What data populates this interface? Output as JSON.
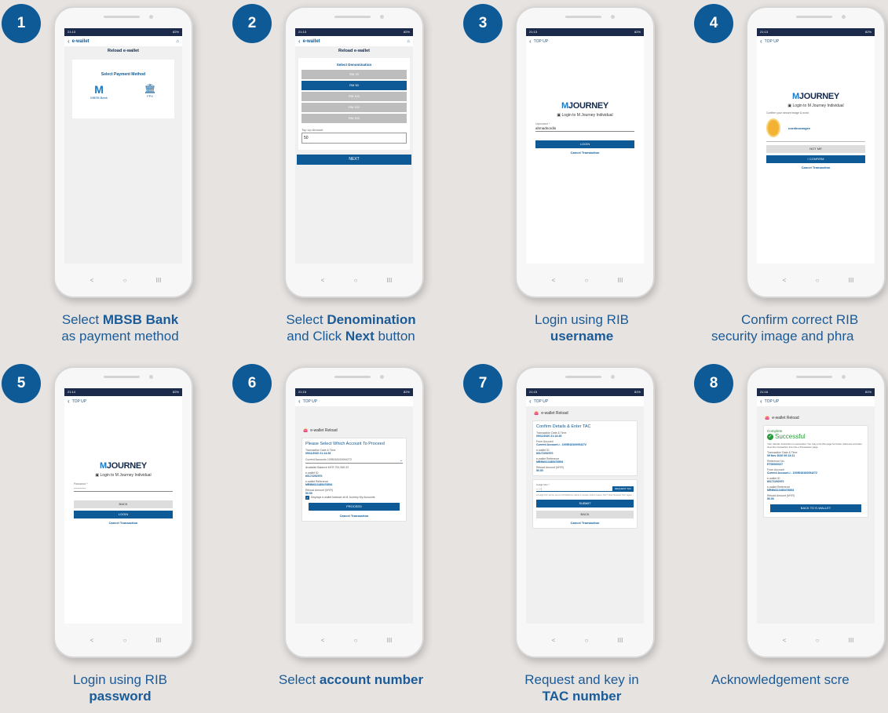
{
  "steps": [
    {
      "number": "1",
      "cap_pre": "Select ",
      "cap_bold": "MBSB Bank",
      "cap_post": "as payment method"
    },
    {
      "number": "2",
      "cap_pre": "Select ",
      "cap_bold": "Denomination",
      "cap_post_pre": "and Click ",
      "cap_bold2": "Next",
      "cap_post": " button"
    },
    {
      "number": "3",
      "cap_pre": "Login using RIB",
      "cap_bold": "username"
    },
    {
      "number": "4",
      "cap_pre": "Confirm correct RIB",
      "cap_post": "security image and phra"
    },
    {
      "number": "5",
      "cap_pre": "Login using RIB",
      "cap_bold": "password"
    },
    {
      "number": "6",
      "cap_pre": "Select ",
      "cap_bold": "account number"
    },
    {
      "number": "7",
      "cap_pre": "Request and key in",
      "cap_bold": "TAC number"
    },
    {
      "number": "8",
      "cap_pre": "Acknowledgement scre"
    }
  ],
  "status": {
    "t1": "21:13",
    "t2": "21:13",
    "t3": "21:13",
    "t4": "21:13",
    "t5": "21:14",
    "t6": "21:15",
    "t7": "21:15",
    "t8": "21:16",
    "batt1": "82%",
    "batt7": "81%"
  },
  "nav": {
    "topup": "TOP UP",
    "nav_back": "<",
    "nav_home": "○",
    "nav_recent": "III"
  },
  "s1": {
    "brand": "e-wallet",
    "title": "Reload e-wallet",
    "select_label": "Select Payment Method",
    "opt1": "MBSB Bank",
    "opt2": "FPX"
  },
  "s2": {
    "brand": "e-wallet",
    "title": "Reload e-wallet",
    "select_label": "Select Denomination",
    "denoms": [
      "RM 25",
      "RM 50",
      "RM 100",
      "RM 150",
      "RM 200"
    ],
    "amount_label": "Top Up Amount",
    "amount_value": "50",
    "next": "NEXT"
  },
  "login": {
    "logo_m": "M",
    "logo_rest": "JOURNEY",
    "login_to": "Login to M Journey Individual",
    "username_label": "Username *",
    "username_value": "ahmadnordin",
    "password_label": "Password *",
    "password_value": "----------",
    "login_btn": "LOGIN",
    "back_btn": "BACK",
    "cancel": "Cancel Transaction",
    "confirm_line": "Confirm your secure image & word",
    "phrase": "nordinorangee",
    "not_me": "NOT ME",
    "confirm_btn": "I CONFIRM"
  },
  "reload": {
    "head": "e-wallet Reload",
    "which_title": "Please Select Which Account To Proceed",
    "date_label": "Transaction Date & Time",
    "date_value": "09/11/2020 21:14:26",
    "from_label": "From Account *",
    "from_value": "Current Accounts 1005018100094272",
    "avail": "Available Balance MYR 791,568.33",
    "ewid_label": "e-wallet ID",
    "ewid_value": "60172292970",
    "ref_label": "e-wallet Reference",
    "ref_value": "MRIB6313485476554",
    "amt_label": "Reload Amount (MYR)",
    "amt_value": "50.00",
    "check_label": "Displays e-wallet balance at M Journey My Accounts",
    "proceed": "PROCEED",
    "cancel": "Cancel Transaction"
  },
  "tac": {
    "title": "Confirm Details & Enter TAC",
    "date_label": "Transaction Date & Time",
    "date_value": "09/11/2020 21:14:26",
    "from_label": "From Account",
    "from_value": "Current Account-i - 1005018100094272",
    "ewid_label": "e-wallet ID",
    "ewid_value": "60172292970",
    "ref_label": "e-wallet Reference",
    "ref_value": "MRIB6313485476554",
    "amt_label": "Reload Amount (MYR)",
    "amt_value": "50.00",
    "tac_label": "6-digit TAC *",
    "tac_value": "-----|",
    "request_btn": "REQUEST TAC",
    "tac_note": "A 6-digit TAC will be sent to 0172292xxxx within 3 minutes. Didn't receive TAC? Click 'Request TAC' again.",
    "submit": "SUBMIT",
    "back": "BACK",
    "cancel": "Cancel Transaction"
  },
  "done": {
    "head": "e-wallet Reload",
    "complete": "Complete",
    "success": "Successful",
    "msg": "Your transfer instruction is successful. You may print this page for future reference and also view this transaction from the eTransaction page.",
    "date_label": "Transaction Date & Time",
    "date_value": "09 Nov 2020 09:13:21",
    "refno_label": "Reference No.",
    "refno_value": "ET00000027",
    "from_label": "From Account",
    "from_value": "Current Account-i - 1005018100094272",
    "ewid_label": "e-wallet ID",
    "ewid_value": "60172292970",
    "ref_label": "e-wallet Reference",
    "ref_value": "MRIB6313485476554",
    "amt_label": "Reload Amount (MYR)",
    "amt_value": "50.00",
    "back_btn": "BACK TO E-WALLET"
  },
  "colors": {
    "brand": "#0e5a96",
    "status": "#1b2a4a",
    "bg": "#e7e3e1"
  }
}
